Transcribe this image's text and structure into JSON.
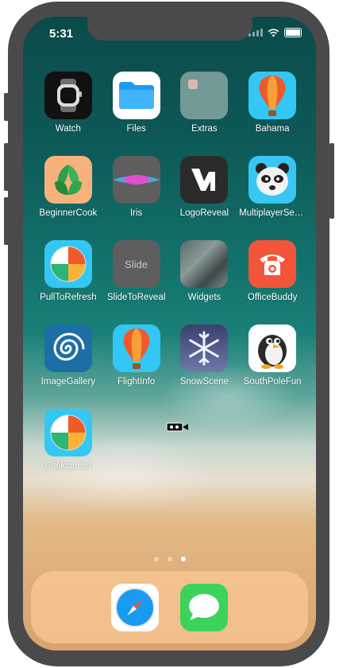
{
  "status_bar": {
    "time": "5:31"
  },
  "apps": [
    {
      "label": "Watch",
      "icon": "watch-icon"
    },
    {
      "label": "Files",
      "icon": "folder-icon"
    },
    {
      "label": "Extras",
      "icon": "folder-group-icon"
    },
    {
      "label": "Bahama",
      "icon": "hot-air-balloon-icon"
    },
    {
      "label": "BeginnerCook",
      "icon": "basil-leaf-icon"
    },
    {
      "label": "Iris",
      "icon": "iris-icon"
    },
    {
      "label": "LogoReveal",
      "icon": "w-logo-icon"
    },
    {
      "label": "MultiplayerSea...",
      "icon": "panda-icon"
    },
    {
      "label": "PullToRefresh",
      "icon": "beach-ball-icon"
    },
    {
      "label": "SlideToReveal",
      "icon": "slide-text-icon",
      "icon_text": "Slide"
    },
    {
      "label": "Widgets",
      "icon": "aerial-photo-icon"
    },
    {
      "label": "OfficeBuddy",
      "icon": "telephone-icon"
    },
    {
      "label": "ImageGallery",
      "icon": "spiral-icon"
    },
    {
      "label": "FlightInfo",
      "icon": "hot-air-balloon-icon"
    },
    {
      "label": "SnowScene",
      "icon": "snowflake-icon"
    },
    {
      "label": "SouthPoleFun",
      "icon": "penguin-icon"
    },
    {
      "label": "PackingList",
      "icon": "beach-ball-icon"
    }
  ],
  "page_indicator": {
    "count": 3,
    "current": 3
  },
  "dock": [
    {
      "name": "safari",
      "icon": "compass-icon"
    },
    {
      "name": "messages",
      "icon": "speech-bubble-icon"
    }
  ],
  "colors": {
    "dock_bg": "#f8c08a",
    "frame": "#4a4a4a",
    "files_blue": "#1e9bf0",
    "messages_green": "#3cd35a",
    "office_red": "#f2553a"
  }
}
